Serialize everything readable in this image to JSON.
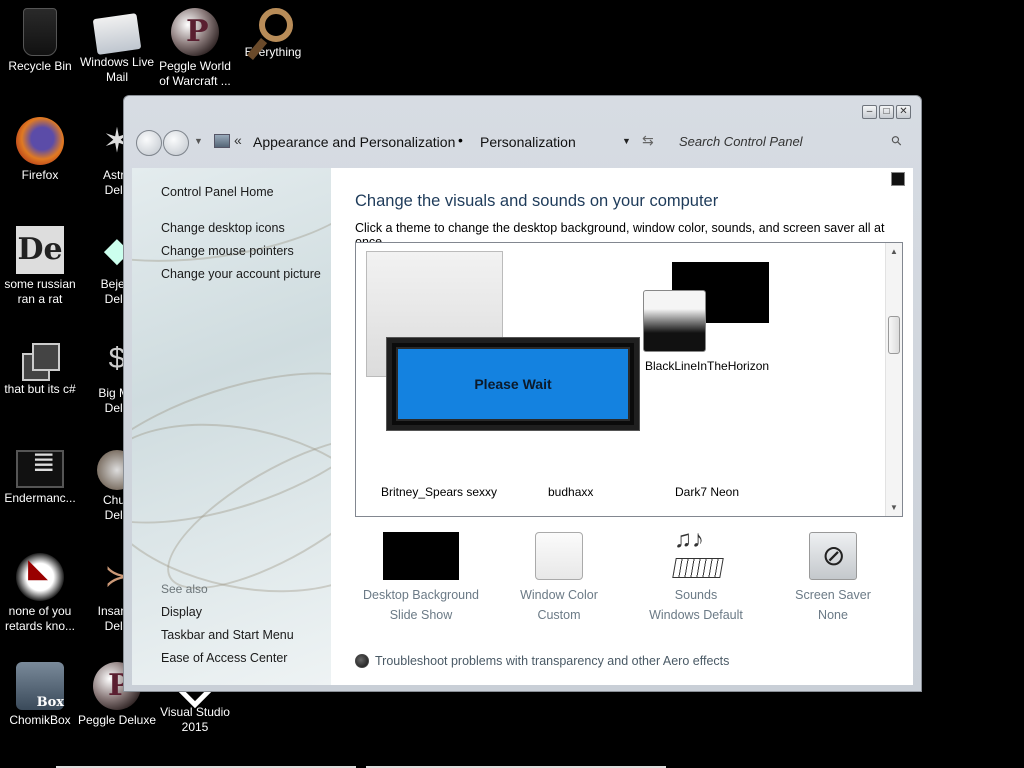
{
  "desktop": {
    "icons": [
      {
        "label": "Recycle Bin",
        "icon": "recycle-bin-icon"
      },
      {
        "label": "Windows Live\nMail",
        "icon": "mail-icon"
      },
      {
        "label": "Peggle World\nof Warcraft ...",
        "icon": "peggle-icon"
      },
      {
        "label": "Everything",
        "icon": "search-magnifier-icon"
      },
      {
        "label": "Firefox",
        "icon": "firefox-icon"
      },
      {
        "label": "Astro\nDelu",
        "icon": "astro-icon"
      },
      {
        "label": "some russian\nran a rat",
        "icon": "de-icon"
      },
      {
        "label": "Bejew\nDelu",
        "icon": "bejeweled-icon"
      },
      {
        "label": "that but its c#",
        "icon": "windows-stack-icon"
      },
      {
        "label": "Big Mo\nDelu",
        "icon": "moneybag-icon"
      },
      {
        "label": "Endermanc...",
        "icon": "terminal-icon"
      },
      {
        "label": "Chuz\nDelu",
        "icon": "chuzzle-icon"
      },
      {
        "label": "none of you\nretards kno...",
        "icon": "dragon-icon"
      },
      {
        "label": "Insaniq\nDelu",
        "icon": "fish-icon"
      },
      {
        "label": "ChomikBox",
        "icon": "chomikbox-icon"
      },
      {
        "label": "Peggle Deluxe",
        "icon": "peggle-icon"
      },
      {
        "label": "Visual Studio\n2015",
        "icon": "visual-studio-icon"
      }
    ]
  },
  "window": {
    "controls": {
      "minimize": "‒",
      "maximize": "□",
      "close": "✕"
    },
    "breadcrumb": {
      "chevron": "«",
      "item1": "Appearance and Personalization",
      "separator": "•",
      "item2": "Personalization"
    },
    "search": {
      "placeholder": "Search Control Panel"
    },
    "sidebar": {
      "home": "Control Panel Home",
      "links": [
        "Change desktop icons",
        "Change mouse pointers",
        "Change your account picture"
      ],
      "see_also_heading": "See also",
      "see_also": [
        "Display",
        "Taskbar and Start Menu",
        "Ease of Access Center"
      ]
    },
    "main": {
      "title": "Change the visuals and sounds on your computer",
      "description": "Click a theme to change the desktop background, window color, sounds, and screen saver all at once.",
      "themes": [
        {
          "label": "BlackLineInTheHorizon"
        },
        {
          "label": "Britney_Spears sexxy"
        },
        {
          "label": "budhaxx"
        },
        {
          "label": "Dark7 Neon"
        }
      ],
      "overlay": "Please Wait",
      "options": [
        {
          "name": "Desktop Background",
          "value": "Slide Show"
        },
        {
          "name": "Window Color",
          "value": "Custom"
        },
        {
          "name": "Sounds",
          "value": "Windows Default"
        },
        {
          "name": "Screen Saver",
          "value": "None"
        }
      ],
      "troubleshoot": "Troubleshoot problems with transparency and other Aero effects"
    }
  },
  "colors": {
    "desktop_bg": "#000000",
    "title_text": "#1e3b5a",
    "please_wait_blue": "#1482e0"
  }
}
